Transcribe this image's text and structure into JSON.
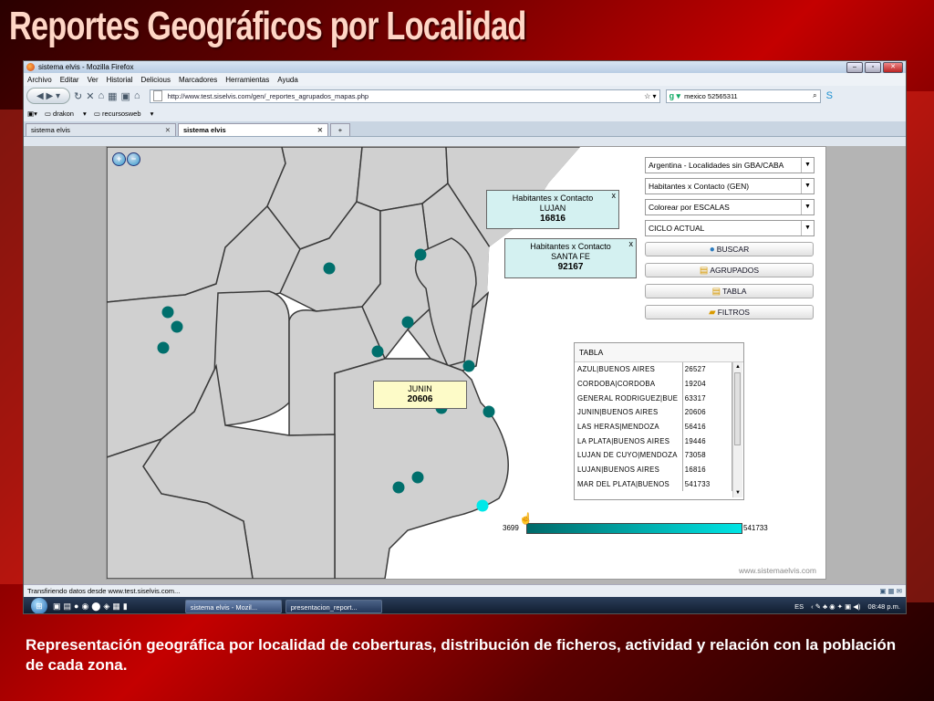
{
  "slide": {
    "title": "Reportes Geográficos por Localidad",
    "caption": "Representación geográfica por localidad de coberturas, distribución de ficheros, actividad y relación con la población de cada zona."
  },
  "browser": {
    "window_title": "sistema elvis - Mozilla Firefox",
    "menu": [
      "Archivo",
      "Editar",
      "Ver",
      "Historial",
      "Delicious",
      "Marcadores",
      "Herramientas",
      "Ayuda"
    ],
    "url": "http://www.test.siselvis.com/gen/_reportes_agrupados_mapas.php",
    "search_value": "mexico 52565311",
    "bookmarks": [
      "drakon",
      "recursosweb"
    ],
    "tabs": [
      {
        "label": "sistema elvis",
        "active": false
      },
      {
        "label": "sistema elvis",
        "active": true
      }
    ],
    "status": "Transfiriendo datos desde www.test.siselvis.com..."
  },
  "controls": {
    "select_region": "Argentina - Localidades sin GBA/CABA",
    "select_metric": "Habitantes x Contacto (GEN)",
    "select_color": "Colorear por ESCALAS",
    "select_cycle": "CICLO ACTUAL",
    "buttons": {
      "buscar": "BUSCAR",
      "agrupados": "AGRUPADOS",
      "tabla": "TABLA",
      "filtros": "FILTROS"
    }
  },
  "tooltips": {
    "lujan": {
      "title": "Habitantes x Contacto",
      "place": "LUJAN",
      "value": "16816"
    },
    "santa_fe": {
      "title": "Habitantes x Contacto",
      "place": "SANTA FE",
      "value": "92167"
    },
    "junin": {
      "place": "JUNIN",
      "value": "20606"
    }
  },
  "table": {
    "title": "TABLA",
    "rows": [
      {
        "loc": "AZUL|BUENOS AIRES",
        "val": "26527"
      },
      {
        "loc": "CORDOBA|CORDOBA",
        "val": "19204"
      },
      {
        "loc": "GENERAL RODRIGUEZ|BUE",
        "val": "63317"
      },
      {
        "loc": "JUNIN|BUENOS AIRES",
        "val": "20606"
      },
      {
        "loc": "LAS HERAS|MENDOZA",
        "val": "56416"
      },
      {
        "loc": "LA PLATA|BUENOS AIRES",
        "val": "19446"
      },
      {
        "loc": "LUJAN DE CUYO|MENDOZA",
        "val": "73058"
      },
      {
        "loc": "LUJAN|BUENOS AIRES",
        "val": "16816"
      },
      {
        "loc": "MAR DEL PLATA|BUENOS",
        "val": "541733"
      }
    ]
  },
  "scale": {
    "min": "3699",
    "max": "541733"
  },
  "watermark": "www.sistemaelvis.com",
  "taskbar": {
    "tasks": [
      "sistema elvis - Mozil...",
      "presentacion_report..."
    ],
    "lang": "ES",
    "clock": "08:48 p.m."
  },
  "colors": {
    "dot": "#006f6c",
    "dot_highlight": "#00e8e8",
    "province_fill": "#d0d0d0"
  }
}
